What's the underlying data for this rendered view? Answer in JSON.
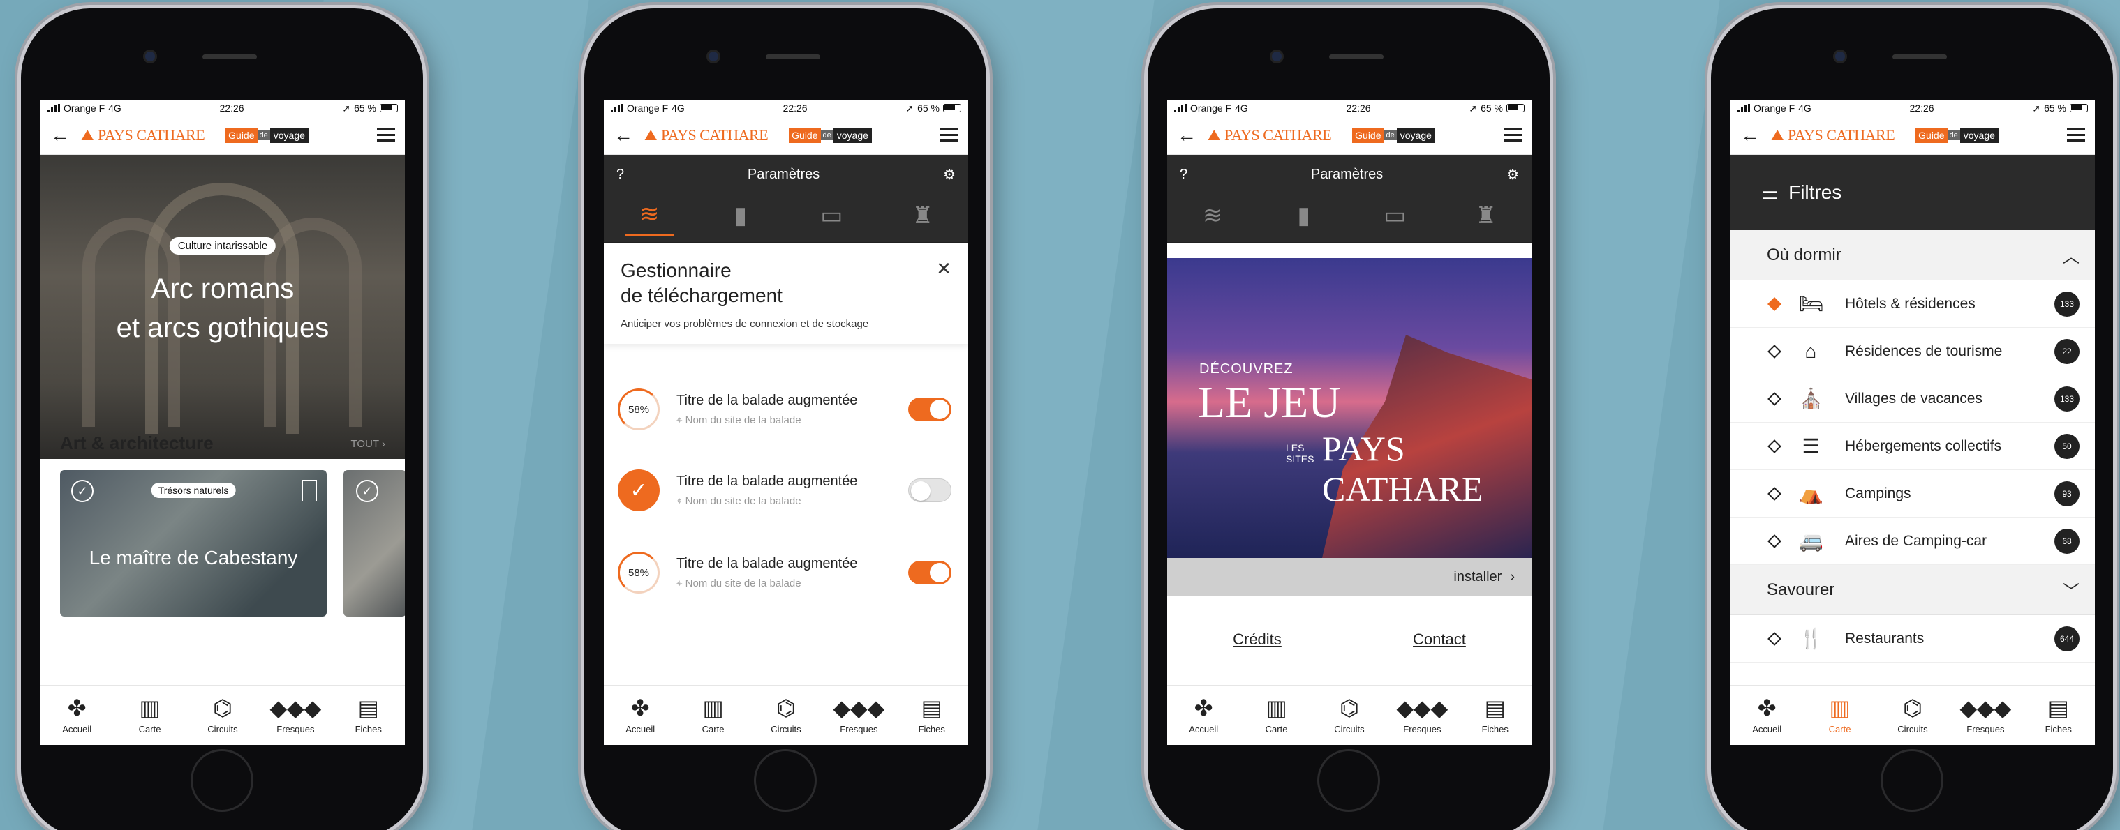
{
  "colors": {
    "accent": "#ee6a1f",
    "background": "#7fb1c2",
    "dark": "#2b2b2b"
  },
  "status": {
    "carrier": "Orange F",
    "network": "4G",
    "time": "22:26",
    "battery": "65 %"
  },
  "header": {
    "logo_text": "PAYS CATHARE",
    "guide": "Guide",
    "de": "de",
    "voyage": "voyage"
  },
  "tabs": [
    {
      "label": "Accueil",
      "icon": "cross-icon"
    },
    {
      "label": "Carte",
      "icon": "map-icon"
    },
    {
      "label": "Circuits",
      "icon": "circuits-icon"
    },
    {
      "label": "Fresques",
      "icon": "fresques-icon"
    },
    {
      "label": "Fiches",
      "icon": "fiches-icon"
    }
  ],
  "phone1": {
    "hero_badge": "Culture intarissable",
    "hero_title_line1": "Arc romans",
    "hero_title_line2": "et arcs gothiques",
    "section_title": "Art & architecture",
    "see_all": "TOUT",
    "card": {
      "tag": "Trésors naturels",
      "title": "Le maître de Cabestany"
    }
  },
  "phone2": {
    "help": "?",
    "title": "Paramètres",
    "dl_title_line1": "Gestionnaire",
    "dl_title_line2": "de téléchargement",
    "dl_subtitle": "Anticiper vos problèmes de connexion et de stockage",
    "items": [
      {
        "progress": "58%",
        "title": "Titre de la balade augmentée",
        "site": "Nom du site de la balade",
        "enabled": true
      },
      {
        "progress": "100%",
        "title": "Titre de la balade augmentée",
        "site": "Nom du site de la balade",
        "enabled": false
      },
      {
        "progress": "58%",
        "title": "Titre de la balade augmentée",
        "site": "Nom du site de la balade",
        "enabled": true
      }
    ]
  },
  "phone3": {
    "help": "?",
    "title": "Paramètres",
    "poster_line1": "DÉCOUVREZ",
    "poster_line2": "LE JEU",
    "poster_les": "LES",
    "poster_sites": "SITES",
    "poster_line3": "PAYS CATHARE",
    "install": "installer",
    "credits": "Crédits",
    "contact": "Contact"
  },
  "phone4": {
    "title": "Filtres",
    "section1": "Où dormir",
    "items": [
      {
        "label": "Hôtels & résidences",
        "count": "133",
        "selected": true,
        "icon": "bed-icon"
      },
      {
        "label": "Résidences de tourisme",
        "count": "22",
        "selected": false,
        "icon": "residence-icon"
      },
      {
        "label": "Villages de vacances",
        "count": "133",
        "selected": false,
        "icon": "village-icon"
      },
      {
        "label": "Hébergements collectifs",
        "count": "50",
        "selected": false,
        "icon": "bunk-icon"
      },
      {
        "label": "Campings",
        "count": "93",
        "selected": false,
        "icon": "tent-icon"
      },
      {
        "label": "Aires de Camping-car",
        "count": "68",
        "selected": false,
        "icon": "campervan-icon"
      }
    ],
    "section2": "Savourer",
    "items2": [
      {
        "label": "Restaurants",
        "count": "644",
        "selected": false,
        "icon": "fork-knife-icon"
      }
    ]
  }
}
